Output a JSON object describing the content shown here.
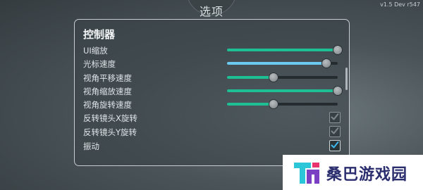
{
  "header": {
    "title": "选项"
  },
  "version": "v1.5 Dev r547",
  "panel": {
    "title": "控制器",
    "sliders": [
      {
        "label": "UI缩放",
        "value": 1.0,
        "fill_color": "#1fbf94"
      },
      {
        "label": "光标速度",
        "value": 0.9,
        "fill_color": "#6cc9ef"
      },
      {
        "label": "视角平移速度",
        "value": 0.42,
        "fill_color": "#1fbf94"
      },
      {
        "label": "视角缩放速度",
        "value": 1.0,
        "fill_color": "#1fbf94"
      },
      {
        "label": "视角旋转速度",
        "value": 0.42,
        "fill_color": "#1fbf94"
      }
    ],
    "toggles": [
      {
        "label": "反转镜头X旋转",
        "checked": true,
        "active": false
      },
      {
        "label": "反转镜头Y旋转",
        "checked": true,
        "active": false
      },
      {
        "label": "振动",
        "checked": true,
        "active": true
      }
    ],
    "check_color_inactive": "#7f888c",
    "check_color_active": "#3db8f0"
  },
  "watermark": {
    "text": "桑巴游戏园",
    "logo_colors": [
      "#2bc7d9",
      "#7b3fc4",
      "#e8336f"
    ]
  }
}
